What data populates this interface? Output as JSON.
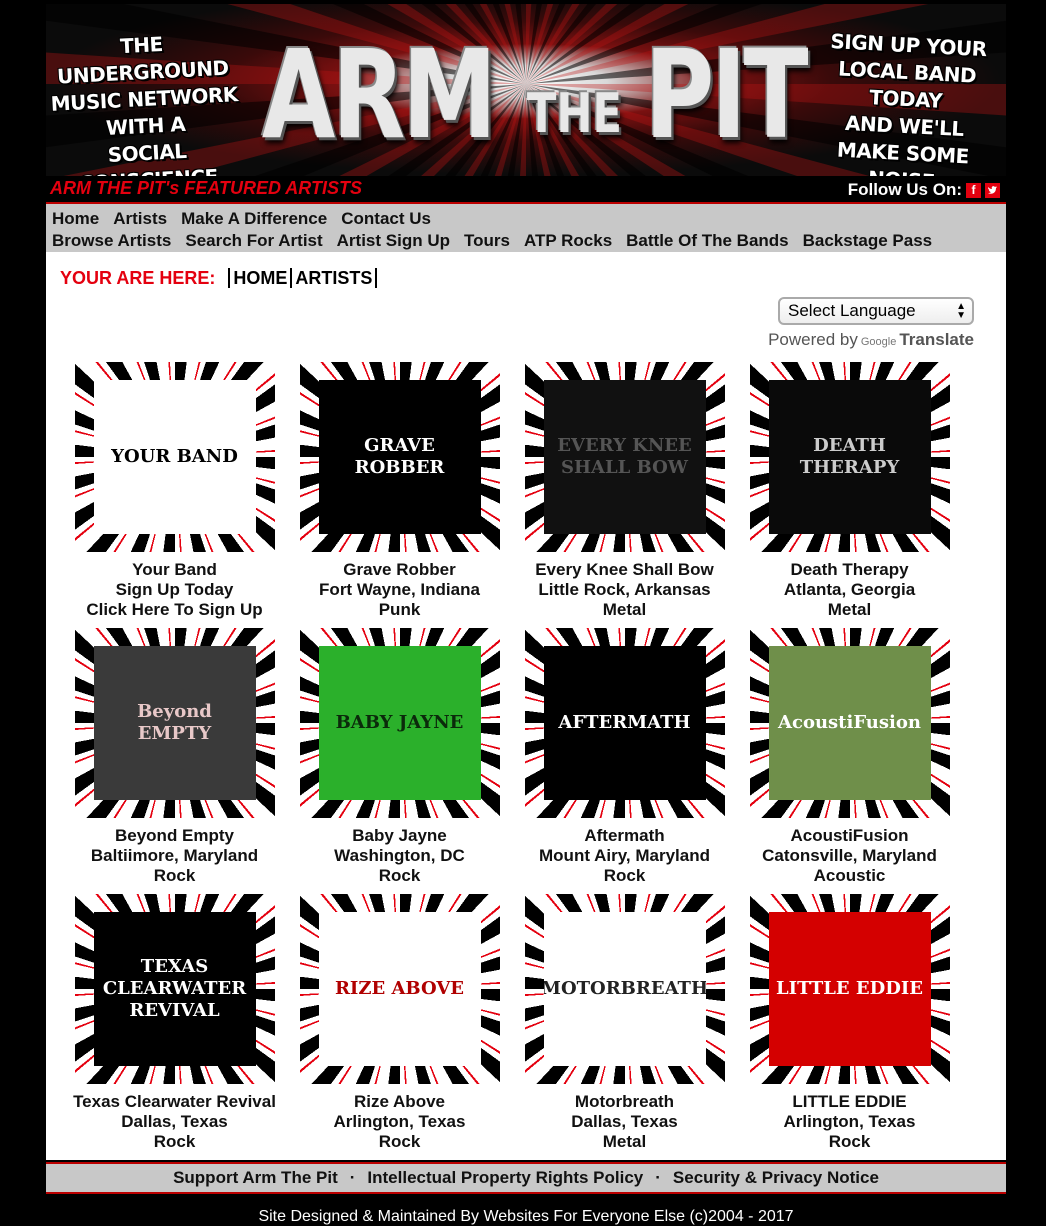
{
  "banner": {
    "left_lines": [
      "THE UNDERGROUND",
      "MUSIC NETWORK",
      "WITH A",
      "SOCIAL CONSCIENCE"
    ],
    "logo_arm": "ARM",
    "logo_the": "THE",
    "logo_pit": "PIT",
    "right_lines": [
      "SIGN UP YOUR",
      "LOCAL BAND TODAY",
      "AND WE'LL",
      "MAKE SOME NOISE"
    ]
  },
  "featured_label": "ARM THE PIT's FEATURED ARTISTS",
  "follow": {
    "label": "Follow Us On:",
    "facebook": "f",
    "twitter": "t"
  },
  "nav": {
    "row1": [
      "Home",
      "Artists",
      "Make A Difference",
      "Contact Us"
    ],
    "row2": [
      "Browse Artists",
      "Search For Artist",
      "Artist Sign Up",
      "Tours",
      "ATP Rocks",
      "Battle Of The Bands",
      "Backstage Pass"
    ]
  },
  "breadcrumb": {
    "label": "YOUR ARE HERE:",
    "items": [
      "HOME",
      "ARTISTS"
    ]
  },
  "translate": {
    "select": "Select Language",
    "powered": "Powered by",
    "google": "Google",
    "translate": "Translate"
  },
  "artists": [
    {
      "name": "Your Band",
      "line2": "Sign Up Today",
      "line3": "Click Here To Sign Up",
      "art": "YOUR BAND",
      "bg": "#ffffff",
      "fg": "#000000"
    },
    {
      "name": "Grave Robber",
      "line2": "Fort Wayne, Indiana",
      "line3": "Punk",
      "art": "GRAVE ROBBER",
      "bg": "#000000",
      "fg": "#ffffff"
    },
    {
      "name": "Every Knee Shall Bow",
      "line2": "Little Rock, Arkansas",
      "line3": "Metal",
      "art": "EVERY KNEE SHALL BOW",
      "bg": "#111111",
      "fg": "#555555"
    },
    {
      "name": "Death Therapy",
      "line2": "Atlanta, Georgia",
      "line3": "Metal",
      "art": "DEATH THERAPY",
      "bg": "#0a0a0a",
      "fg": "#cccccc"
    },
    {
      "name": "Beyond Empty",
      "line2": "Baltiimore, Maryland",
      "line3": "Rock",
      "art": "Beyond EMPTY",
      "bg": "#3a3a3a",
      "fg": "#e8c8c8"
    },
    {
      "name": "Baby Jayne",
      "line2": "Washington, DC",
      "line3": "Rock",
      "art": "BABY JAYNE",
      "bg": "#2bb02b",
      "fg": "#0b2a0b"
    },
    {
      "name": "Aftermath",
      "line2": "Mount Airy, Maryland",
      "line3": "Rock",
      "art": "AFTERMATH",
      "bg": "#000000",
      "fg": "#ffffff"
    },
    {
      "name": "AcoustiFusion",
      "line2": "Catonsville, Maryland",
      "line3": "Acoustic",
      "art": "AcoustiFusion",
      "bg": "#6f8f4a",
      "fg": "#ffffff"
    },
    {
      "name": "Texas Clearwater Revival",
      "line2": "Dallas, Texas",
      "line3": "Rock",
      "art": "TEXAS CLEARWATER REVIVAL",
      "bg": "#000000",
      "fg": "#ffffff"
    },
    {
      "name": "Rize Above",
      "line2": "Arlington, Texas",
      "line3": "Rock",
      "art": "RIZE ABOVE",
      "bg": "#ffffff",
      "fg": "#b00000"
    },
    {
      "name": "Motorbreath",
      "line2": "Dallas, Texas",
      "line3": "Metal",
      "art": "MOTORBREATH",
      "bg": "#ffffff",
      "fg": "#222222"
    },
    {
      "name": "LITTLE EDDIE",
      "line2": "Arlington, Texas",
      "line3": "Rock",
      "art": "LITTLE EDDIE",
      "bg": "#d40000",
      "fg": "#ffffff"
    }
  ],
  "footer": {
    "links": [
      "Support Arm The Pit",
      "Intellectual Property Rights Policy",
      "Security & Privacy Notice"
    ],
    "separator": "·",
    "credit": "Site Designed & Maintained By  Websites For Everyone Else  (c)2004 - 2017"
  },
  "colors": {
    "accent_red": "#e4000f",
    "nav_gray": "#c8c8c8"
  }
}
